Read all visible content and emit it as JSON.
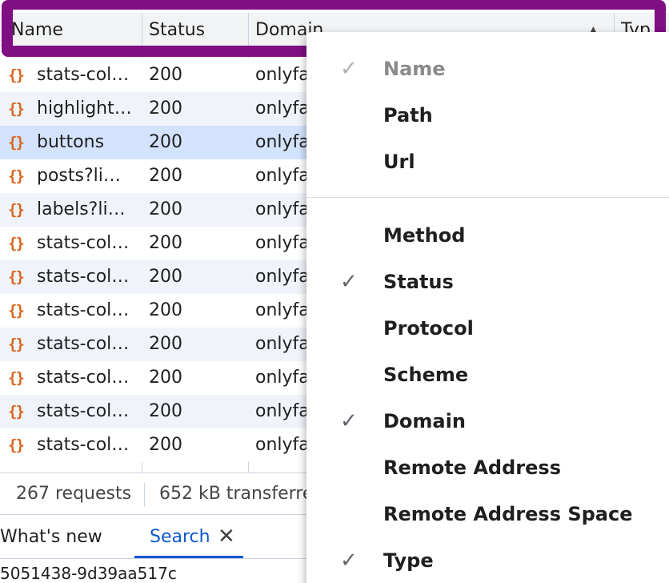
{
  "table": {
    "headers": [
      "Name",
      "Status",
      "Domain",
      "Typ"
    ],
    "sort_glyph": "▲",
    "rows": [
      {
        "name": "stats-col…",
        "status": "200",
        "domain": "onlyfa",
        "state": "odd"
      },
      {
        "name": "highlight…",
        "status": "200",
        "domain": "onlyfa",
        "state": "even"
      },
      {
        "name": "buttons",
        "status": "200",
        "domain": "onlyfa",
        "state": "sel"
      },
      {
        "name": "posts?li…",
        "status": "200",
        "domain": "onlyfa",
        "state": "odd"
      },
      {
        "name": "labels?li…",
        "status": "200",
        "domain": "onlyfa",
        "state": "even"
      },
      {
        "name": "stats-col…",
        "status": "200",
        "domain": "onlyfa",
        "state": "odd"
      },
      {
        "name": "stats-col…",
        "status": "200",
        "domain": "onlyfa",
        "state": "even"
      },
      {
        "name": "stats-col…",
        "status": "200",
        "domain": "onlyfa",
        "state": "odd"
      },
      {
        "name": "stats-col…",
        "status": "200",
        "domain": "onlyfa",
        "state": "even"
      },
      {
        "name": "stats-col…",
        "status": "200",
        "domain": "onlyfa",
        "state": "odd"
      },
      {
        "name": "stats-col…",
        "status": "200",
        "domain": "onlyfa",
        "state": "even"
      },
      {
        "name": "stats-col…",
        "status": "200",
        "domain": "onlyfa",
        "state": "odd"
      }
    ],
    "row_icon_glyph": "{}",
    "row_icon_name": "json-file-icon"
  },
  "summary": {
    "requests": "267 requests",
    "transferred": "652 kB transferre"
  },
  "drawer": {
    "tabs": [
      "What's new",
      "Search"
    ],
    "active_tab": "Search",
    "close_glyph": "✕",
    "search_result_line": "5051438-9d39aa517c"
  },
  "menu": {
    "check_glyph": "✓",
    "group1": [
      {
        "label": "Name",
        "checked": true,
        "disabled": true
      },
      {
        "label": "Path",
        "checked": false,
        "disabled": false
      },
      {
        "label": "Url",
        "checked": false,
        "disabled": false
      }
    ],
    "group2": [
      {
        "label": "Method",
        "checked": false
      },
      {
        "label": "Status",
        "checked": true
      },
      {
        "label": "Protocol",
        "checked": false
      },
      {
        "label": "Scheme",
        "checked": false
      },
      {
        "label": "Domain",
        "checked": true
      },
      {
        "label": "Remote Address",
        "checked": false
      },
      {
        "label": "Remote Address Space",
        "checked": false
      },
      {
        "label": "Type",
        "checked": true
      }
    ]
  },
  "colors": {
    "highlight_border": "#7f0f83",
    "selected_row": "#d3e3fd",
    "accent": "#0b57d0",
    "json_icon": "#d9661f"
  }
}
